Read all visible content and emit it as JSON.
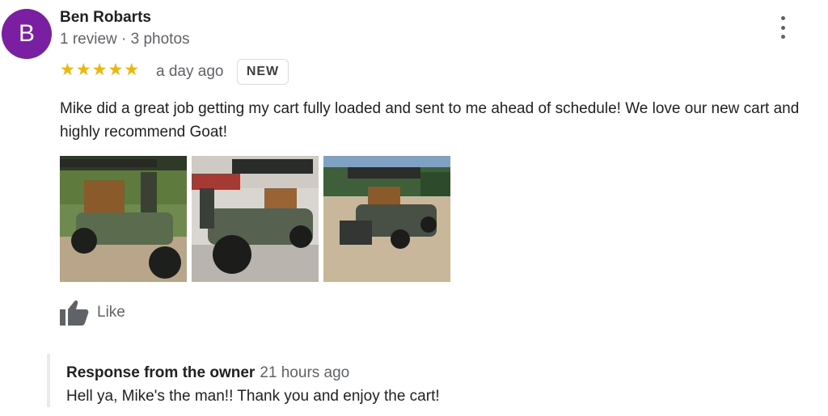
{
  "reviewer": {
    "initial": "B",
    "avatar_color": "#7b1fa2",
    "name": "Ben Robarts",
    "meta": "1 review · 3 photos"
  },
  "rating": {
    "stars": 5,
    "max_stars": 5,
    "star_color": "#f4b400",
    "star_glyph": "★",
    "time_ago": "a day ago",
    "badge": "NEW"
  },
  "review": {
    "text": "Mike did a great job getting my cart fully loaded and sent to me ahead of schedule! We love our new cart and highly recommend Goat!"
  },
  "photos": [
    {
      "icon": "golf-cart-photo"
    },
    {
      "icon": "golf-cart-photo"
    },
    {
      "icon": "golf-cart-photo"
    }
  ],
  "actions": {
    "like_label": "Like",
    "like_icon": "thumbs-up-icon",
    "more_icon": "more-vertical-icon"
  },
  "owner_response": {
    "title": "Response from the owner",
    "time_ago": "21 hours ago",
    "text": "Hell ya, Mike's the man!! Thank you and enjoy the cart!"
  }
}
